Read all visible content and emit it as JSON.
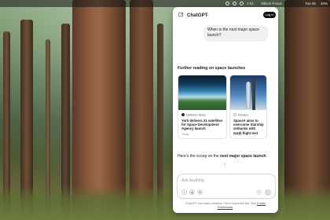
{
  "menubar": {
    "left_text": "",
    "items": [
      "1:01",
      "Silicon Focus",
      "Tue 26",
      "40%"
    ]
  },
  "panel": {
    "app_title": "ChatGPT",
    "login_label": "Log in",
    "user_message": "When is the next major space launch?",
    "further_heading": "Further reading on space launches",
    "cards": [
      {
        "source": "Defense News",
        "title": "York delivers 21 satellites for Space Development Agency launch",
        "date": "Today"
      },
      {
        "source": "Reuters",
        "title": "SpaceX aims to overcome Starship setbacks with tenth flight test",
        "date": "Today"
      }
    ],
    "scoop_prefix": "Here's the scoop on the",
    "scoop_bold": "next major space launch",
    "scoop_suffix": ":",
    "composer_placeholder": "Ask anything",
    "disclaimer_main": "ChatGPT can make mistakes. Check important info. See",
    "disclaimer_link": "Cookie Preferences",
    "disclaimer_end": "."
  },
  "icons": {
    "new_chat": "new-chat-icon",
    "chevron": "chevron-down-icon",
    "attach": "plus-icon",
    "globe": "globe-icon",
    "tools": "tools-icon",
    "voice": "voice-icon",
    "send": "send-arrow-icon",
    "scroll_down": "arrow-down-icon"
  },
  "colors": {
    "login_bg": "#111111",
    "bubble_bg": "#f0f0f0",
    "panel_bg": "#ffffff"
  }
}
